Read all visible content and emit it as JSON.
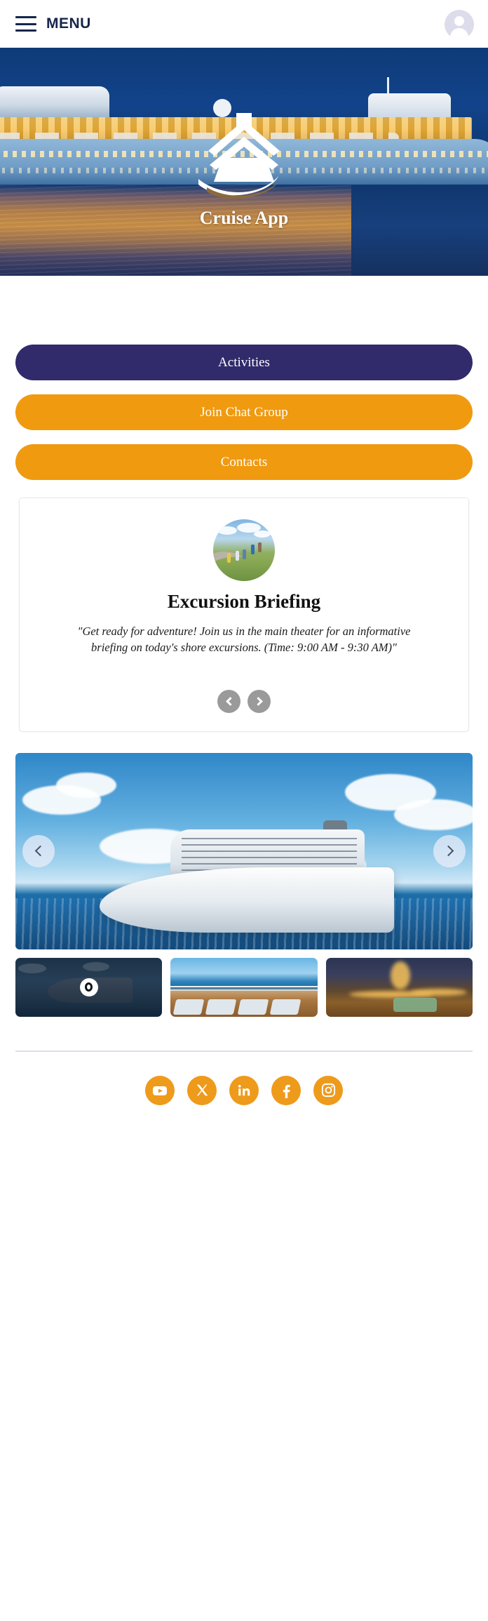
{
  "header": {
    "menu_label": "MENU",
    "menu_icon": "hamburger-icon",
    "avatar_icon": "user-avatar-icon"
  },
  "hero": {
    "title": "Cruise App",
    "logo_icon": "cruise-ship-logo",
    "background": "cruise-ship-at-sunset-photo"
  },
  "actions": [
    {
      "label": "Activities",
      "style": "primary",
      "name": "activities-button"
    },
    {
      "label": "Join Chat Group",
      "style": "accent",
      "name": "join-chat-group-button"
    },
    {
      "label": "Contacts",
      "style": "accent",
      "name": "contacts-button"
    }
  ],
  "announcement": {
    "image": "hikers-on-mountain-photo",
    "title": "Excursion Briefing",
    "text": "\"Get ready for adventure! Join us in the main theater for an informative briefing on today's shore excursions. (Time: 9:00 AM - 9:30 AM)\"",
    "prev_label": "Previous announcement",
    "next_label": "Next announcement",
    "prev_icon": "chevron-left-icon",
    "next_icon": "chevron-right-icon"
  },
  "gallery": {
    "main_image": "cruise-ship-on-open-ocean-photo",
    "prev_icon": "chevron-left-icon",
    "next_icon": "chevron-right-icon",
    "prev_label": "Previous image",
    "next_label": "Next image",
    "thumbnails": [
      {
        "name": "thumbnail-ship-at-dusk",
        "image": "ship-at-dusk-photo",
        "active": true,
        "badge_icon": "eye-icon"
      },
      {
        "name": "thumbnail-sun-deck",
        "image": "sun-deck-loungers-photo",
        "active": false,
        "badge_icon": ""
      },
      {
        "name": "thumbnail-night-deck",
        "image": "illuminated-night-deck-photo",
        "active": false,
        "badge_icon": ""
      }
    ]
  },
  "footer": {
    "socials": [
      {
        "name": "youtube-icon",
        "label": "YouTube"
      },
      {
        "name": "x-twitter-icon",
        "label": "X"
      },
      {
        "name": "linkedin-icon",
        "label": "LinkedIn"
      },
      {
        "name": "facebook-icon",
        "label": "Facebook"
      },
      {
        "name": "instagram-icon",
        "label": "Instagram"
      }
    ]
  },
  "colors": {
    "primary": "#312a6b",
    "accent": "#f09a10",
    "social": "#ee9a1b",
    "header_text": "#16264a",
    "divider": "#dfdcee"
  }
}
